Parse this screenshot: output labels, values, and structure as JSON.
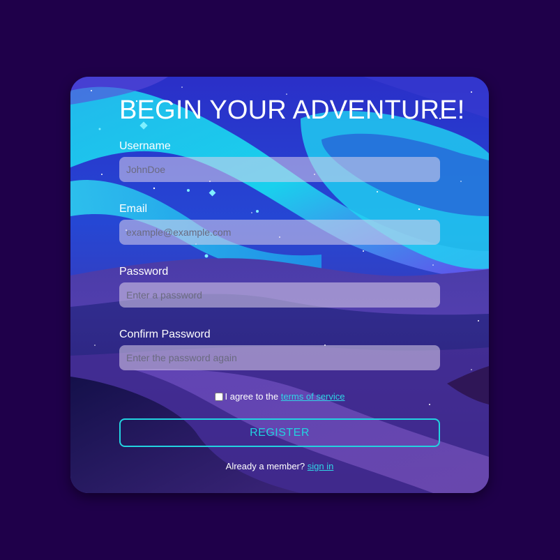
{
  "form": {
    "title": "BEGIN YOUR ADVENTURE!",
    "username_label": "Username",
    "username_placeholder": "JohnDoe",
    "email_label": "Email",
    "email_placeholder": "example@example.com",
    "password_label": "Password",
    "password_placeholder": "Enter a password",
    "confirm_label": "Confirm Password",
    "confirm_placeholder": "Enter the password again",
    "agree_text": "I agree to the",
    "terms_link": "terms of service",
    "register_button": "REGISTER",
    "member_text": "Already a member?",
    "signin_link": "sign in"
  },
  "colors": {
    "page_background": "#1f004a",
    "accent": "#22d3e0",
    "link": "#2fd6e6",
    "text": "#ffffff"
  }
}
